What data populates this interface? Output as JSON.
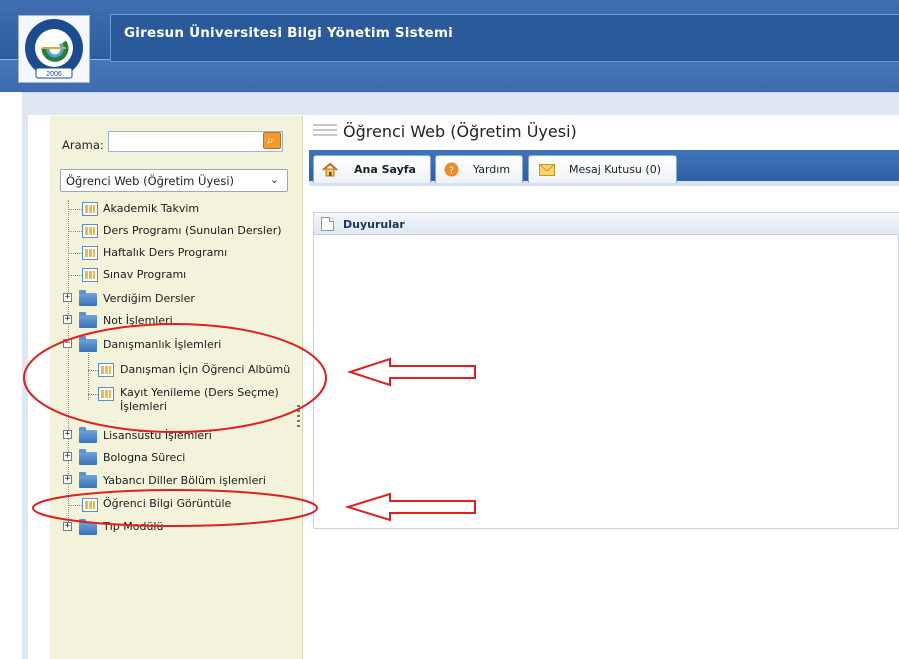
{
  "header": {
    "app_title": "Giresun Üniversitesi Bilgi Yönetim Sistemi",
    "logo_text_top": "ÜNİVERSİTESİ",
    "logo_text_left": "GIRESUN",
    "logo_year": "2006"
  },
  "sidebar": {
    "search_label": "Arama:",
    "search_value": "",
    "search_button_icon": "search-icon",
    "module_select": "Öğrenci Web (Öğretim Üyesi)",
    "tree": [
      {
        "label": "Akademik Takvim",
        "type": "page"
      },
      {
        "label": "Ders Programı (Sunulan Dersler)",
        "type": "page"
      },
      {
        "label": "Haftalık Ders Programı",
        "type": "page"
      },
      {
        "label": "Sınav Programı",
        "type": "page"
      },
      {
        "label": "Verdiğim Dersler",
        "type": "folder",
        "expanded": false
      },
      {
        "label": "Not İşlemleri",
        "type": "folder",
        "expanded": false
      },
      {
        "label": "Danışmanlık İşlemleri",
        "type": "folder",
        "expanded": true,
        "children": [
          {
            "label": "Danışman İçin Öğrenci Albümü",
            "type": "page"
          },
          {
            "label_line1": "Kayıt Yenileme (Ders Seçme)",
            "label_line2": "İşlemleri",
            "type": "page"
          }
        ]
      },
      {
        "label": "Lisansüstü İşlemleri",
        "type": "folder",
        "expanded": false
      },
      {
        "label": "Bologna Süreci",
        "type": "folder",
        "expanded": false
      },
      {
        "label": "Yabancı Diller Bölüm işlemleri",
        "type": "folder",
        "expanded": false
      },
      {
        "label": "Öğrenci Bilgi Görüntüle",
        "type": "page"
      },
      {
        "label": "Tıp Modülü",
        "type": "folder",
        "expanded": false
      }
    ]
  },
  "main": {
    "title": "Öğrenci Web (Öğretim Üyesi)",
    "tabs": [
      {
        "label": "Ana Sayfa",
        "icon": "home-icon",
        "active": true
      },
      {
        "label": "Yardım",
        "icon": "help-icon",
        "active": false
      },
      {
        "label": "Mesaj Kutusu (0)",
        "icon": "envelope-icon",
        "active": false
      }
    ],
    "panel_title": "Duyurular"
  },
  "colors": {
    "header_blue": "#2e5d9f",
    "sidebar_bg": "#f3f3dc",
    "annotation_red": "#e02020",
    "tab_bar": "#3f74b8"
  }
}
